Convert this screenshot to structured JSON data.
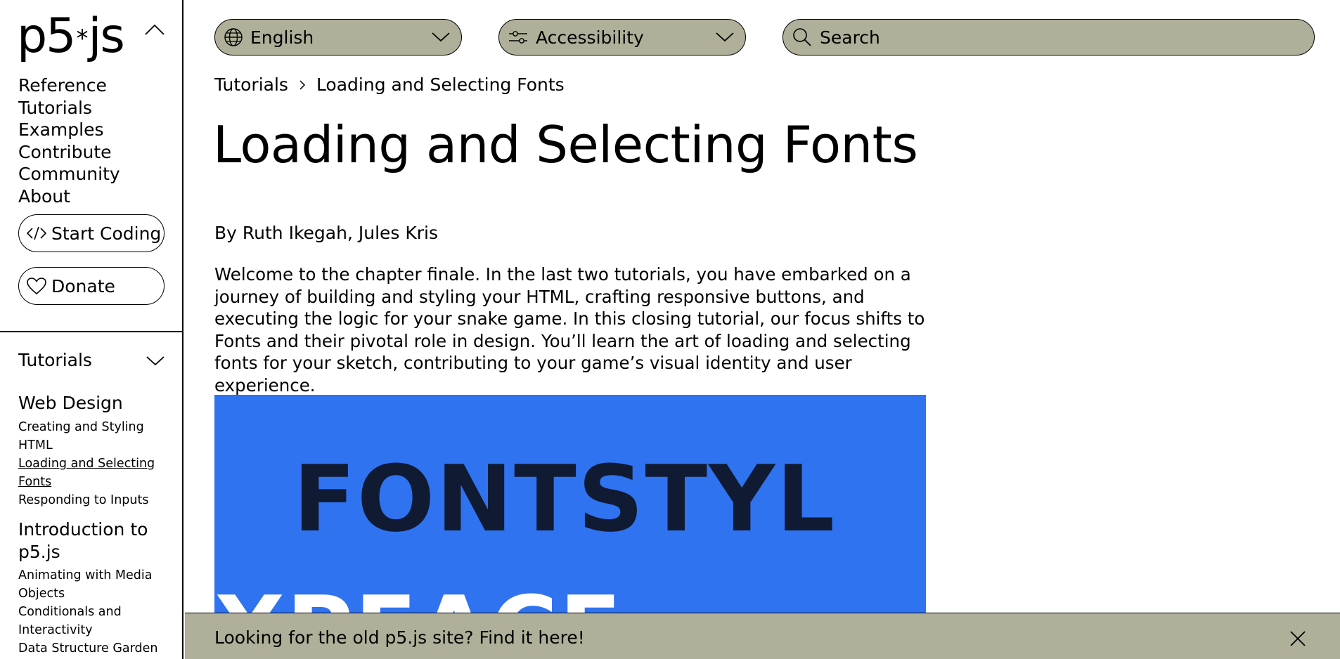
{
  "logo": {
    "left": "p5",
    "star": "*",
    "right": "js"
  },
  "main_nav": [
    "Reference",
    "Tutorials",
    "Examples",
    "Contribute",
    "Community",
    "About"
  ],
  "buttons": {
    "start_coding": "Start Coding",
    "donate": "Donate"
  },
  "sidebar": {
    "tutorials_header": "Tutorials",
    "sections": [
      {
        "title": "Web Design",
        "items": [
          "Creating and Styling HTML",
          "Loading and Selecting Fonts",
          "Responding to Inputs"
        ],
        "active": "Loading and Selecting Fonts"
      },
      {
        "title": "Introduction to p5.js",
        "items": [
          "Animating with Media Objects",
          "Conditionals and Interactivity",
          "Data Structure Garden"
        ]
      }
    ]
  },
  "topbar": {
    "language": "English",
    "accessibility": "Accessibility",
    "search_placeholder": "Search"
  },
  "breadcrumb": {
    "parent": "Tutorials",
    "current": "Loading and Selecting Fonts"
  },
  "page": {
    "title": "Loading and Selecting Fonts",
    "authors": "By Ruth Ikegah, Jules Kris",
    "intro": "Welcome to the chapter finale. In the last two tutorials, you have embarked on a journey of building and styling your HTML, crafting responsive buttons, and executing the logic for your snake game. In this closing tutorial, our focus shifts to Fonts and their pivotal role in design. You’ll learn the art of loading and selecting fonts for your sketch, contributing to your game’s visual identity and user experience."
  },
  "hero_image": {
    "line1": "FONTSTYL",
    "line2": "XPEACE",
    "background": "#2f73f0",
    "text_color": "#101a33"
  },
  "banner": {
    "text": "Looking for the old p5.js site? Find it here!"
  },
  "colors": {
    "control_bg": "#b0b09a",
    "accent": "#2f73f0"
  }
}
